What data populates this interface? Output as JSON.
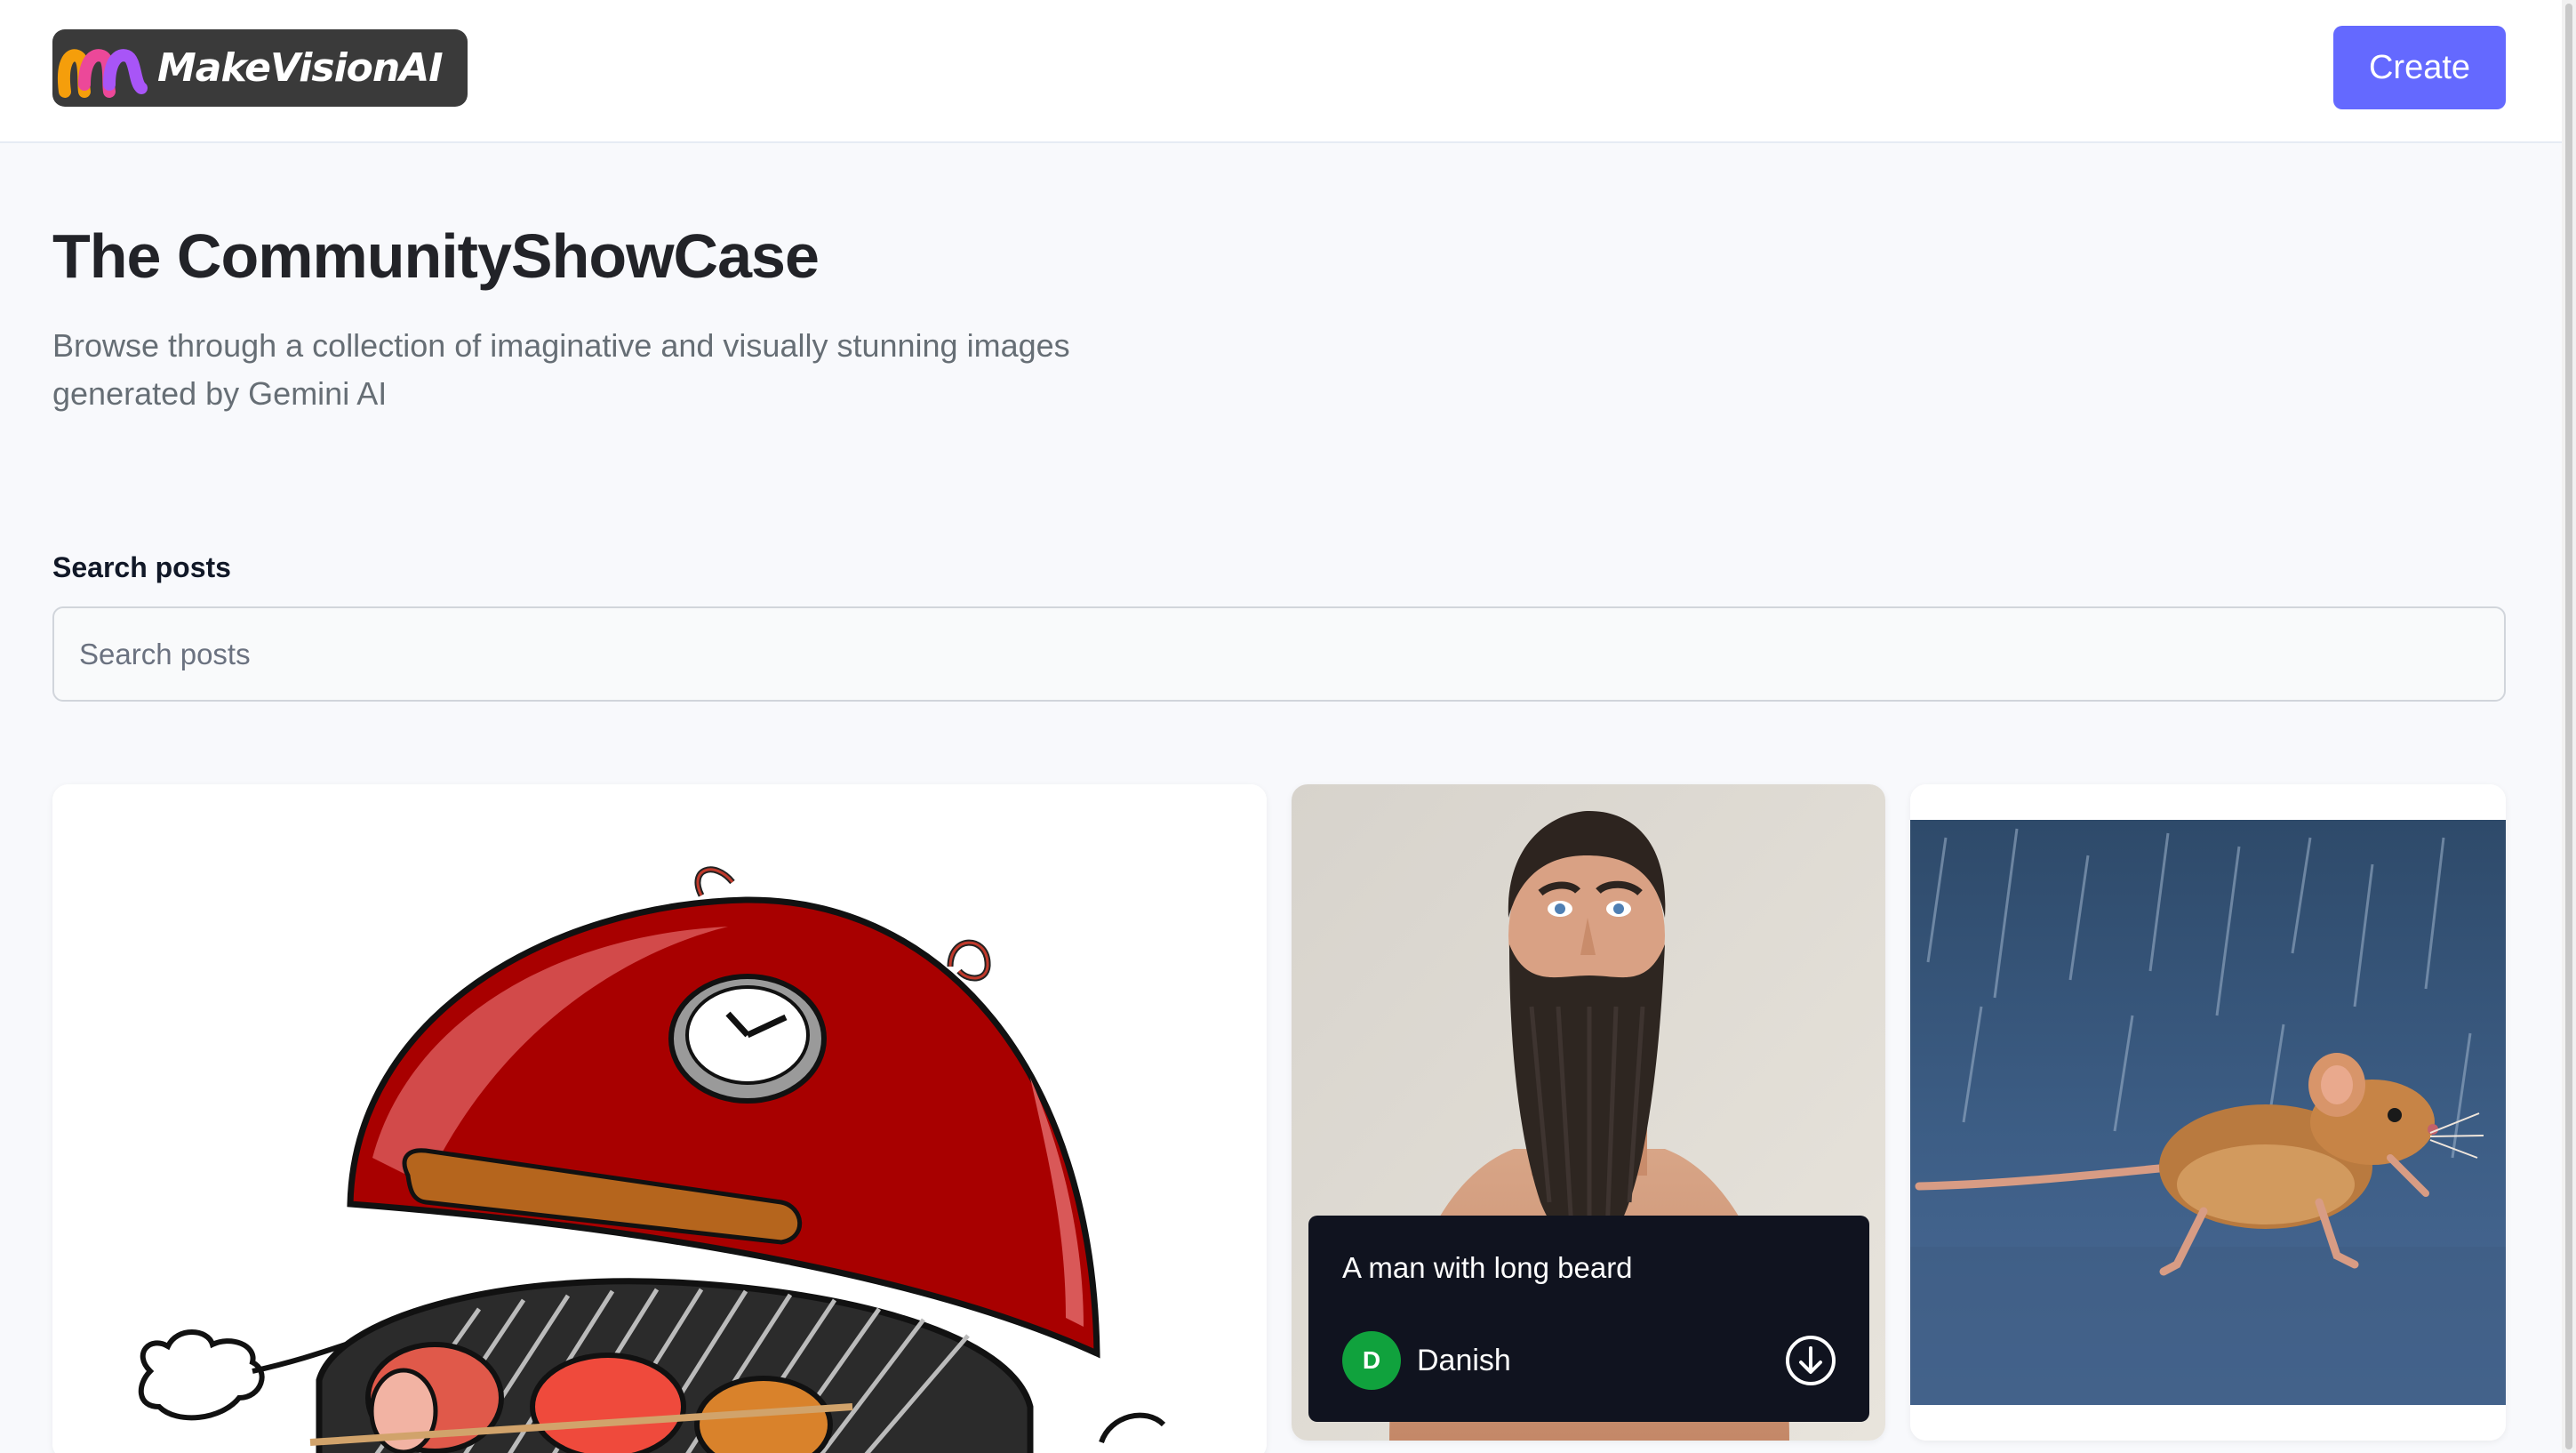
{
  "header": {
    "logo_text": "MakeVisionAI",
    "create_label": "Create"
  },
  "intro": {
    "title": "The CommunityShowCase",
    "subtitle": "Browse through a collection of imaginative and visually stunning images generated by Gemini AI"
  },
  "search": {
    "label": "Search posts",
    "placeholder": "Search posts",
    "value": ""
  },
  "posts": [
    {
      "image": "cartoon-bbq-grill"
    },
    {
      "image": "man-with-long-beard",
      "prompt": "A man with long beard",
      "author": "Danish",
      "avatar_initial": "D"
    },
    {
      "image": "mouse-running-in-rain"
    }
  ],
  "colors": {
    "accent": "#6469ff",
    "avatar": "#10a23d",
    "overlay": "#10131f"
  }
}
